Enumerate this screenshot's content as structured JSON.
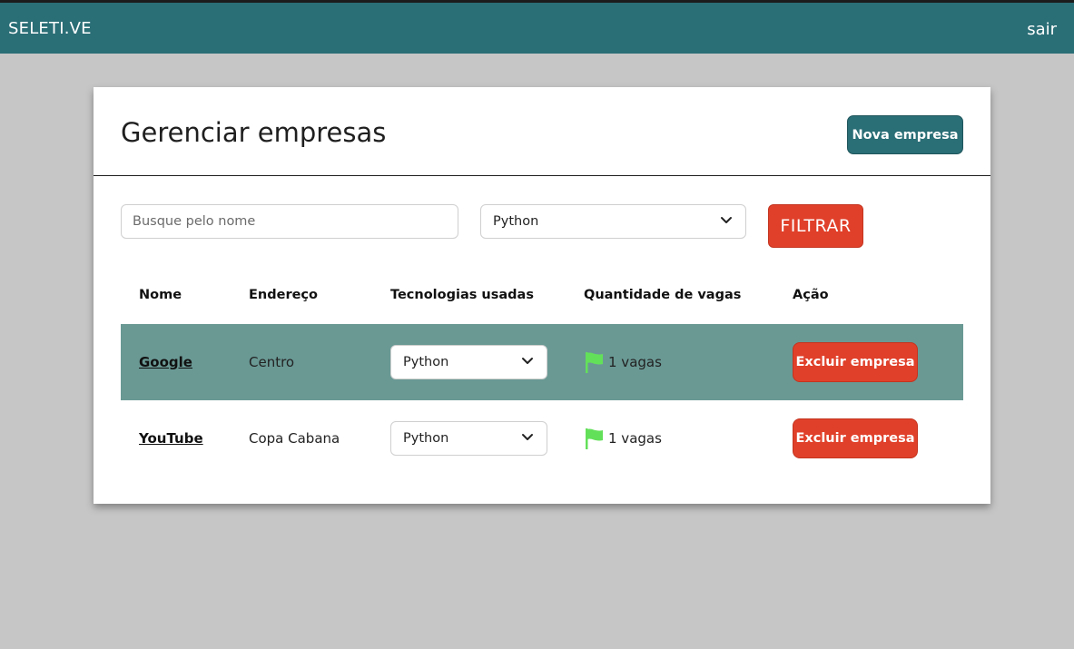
{
  "app": {
    "brand": "SELETI.VE",
    "logout_label": "sair"
  },
  "page": {
    "title": "Gerenciar empresas",
    "new_button": "Nova empresa"
  },
  "filters": {
    "search_placeholder": "Busque pelo nome",
    "technology_selected": "Python",
    "filter_button": "FILTRAR"
  },
  "table": {
    "headers": [
      "Nome",
      "Endereço",
      "Tecnologias usadas",
      "Quantidade de vagas",
      "Ação"
    ],
    "rows": [
      {
        "name": "Google",
        "address": "Centro",
        "technology": "Python",
        "vagas": "1 vagas",
        "action": "Excluir empresa",
        "highlighted": true
      },
      {
        "name": "YouTube",
        "address": "Copa Cabana",
        "technology": "Python",
        "vagas": "1 vagas",
        "action": "Excluir empresa",
        "highlighted": false
      }
    ]
  },
  "colors": {
    "header_bg": "#2a6e76",
    "danger": "#e0402a",
    "row_highlight": "#6a9994",
    "flag": "#63e05a"
  },
  "icons": {
    "vagas_icon": "flag-icon",
    "select_icon": "chevron-down-icon"
  }
}
